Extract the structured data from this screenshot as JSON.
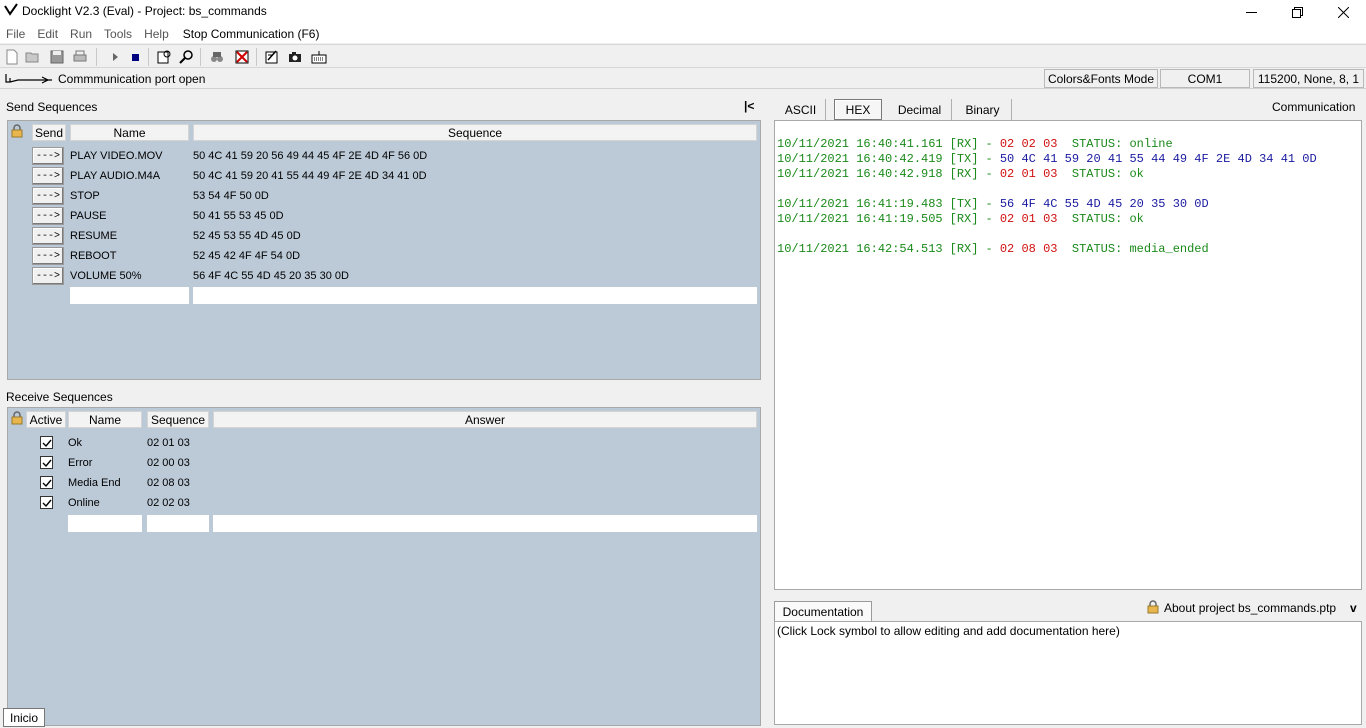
{
  "window": {
    "title": "Docklight V2.3 (Eval) - Project: bs_commands"
  },
  "menu": {
    "items": [
      "File",
      "Edit",
      "Run",
      "Tools",
      "Help"
    ],
    "command": "Stop Communication  (F6)"
  },
  "toolbar": {
    "icons": [
      "new-icon",
      "open-icon",
      "save-icon",
      "print-icon",
      "play-icon",
      "stop-icon",
      "settings-icon",
      "search-icon",
      "find-icon",
      "clear-icon",
      "script-icon",
      "snapshot-icon",
      "keyboard-icon"
    ]
  },
  "status": {
    "message": "Commmunication port open",
    "mode": "Colors&Fonts Mode",
    "port": "COM1",
    "settings": "115200, None, 8, 1"
  },
  "send": {
    "title": "Send Sequences",
    "collapse_glyph": "|<",
    "headers": {
      "send": "Send",
      "name": "Name",
      "sequence": "Sequence"
    },
    "button_label": "--->",
    "rows": [
      {
        "name": "PLAY VIDEO.MOV",
        "sequence": "50 4C 41 59 20 56 49 44 45 4F 2E 4D 4F 56 0D"
      },
      {
        "name": "PLAY AUDIO.M4A",
        "sequence": "50 4C 41 59 20 41 55 44 49 4F 2E 4D 34 41 0D"
      },
      {
        "name": "STOP",
        "sequence": "53 54 4F 50 0D"
      },
      {
        "name": "PAUSE",
        "sequence": "50 41 55 53 45 0D"
      },
      {
        "name": "RESUME",
        "sequence": "52 45 53 55 4D 45 0D"
      },
      {
        "name": "REBOOT",
        "sequence": "52 45 42 4F 4F 54 0D"
      },
      {
        "name": "VOLUME 50%",
        "sequence": "56 4F 4C 55 4D 45 20 35 30 0D"
      }
    ]
  },
  "receive": {
    "title": "Receive Sequences",
    "headers": {
      "active": "Active",
      "name": "Name",
      "sequence": "Sequence",
      "answer": "Answer"
    },
    "rows": [
      {
        "active": true,
        "name": "Ok",
        "sequence": "02 01 03"
      },
      {
        "active": true,
        "name": "Error",
        "sequence": "02 00 03"
      },
      {
        "active": true,
        "name": "Media End",
        "sequence": "02 08 03"
      },
      {
        "active": true,
        "name": "Online",
        "sequence": "02 02 03"
      }
    ]
  },
  "communication": {
    "title": "Communication",
    "tabs": [
      "ASCII",
      "HEX",
      "Decimal",
      "Binary"
    ],
    "active_tab": "HEX",
    "log": [
      {
        "ts": "10/11/2021 16:40:41.161",
        "dir": "[RX]",
        "bytes": "02 02 03",
        "status": "  STATUS: online"
      },
      {
        "ts": "10/11/2021 16:40:42.419",
        "dir": "[TX]",
        "bytes": "50 4C 41 59 20 41 55 44 49 4F 2E 4D 34 41 0D",
        "status": ""
      },
      {
        "ts": "10/11/2021 16:40:42.918",
        "dir": "[RX]",
        "bytes": "02 01 03",
        "status": "  STATUS: ok"
      },
      {
        "ts": "10/11/2021 16:41:19.483",
        "dir": "[TX]",
        "bytes": "56 4F 4C 55 4D 45 20 35 30 0D",
        "status": ""
      },
      {
        "ts": "10/11/2021 16:41:19.505",
        "dir": "[RX]",
        "bytes": "02 01 03",
        "status": "  STATUS: ok"
      },
      {
        "ts": "10/11/2021 16:42:54.513",
        "dir": "[RX]",
        "bytes": "02 08 03",
        "status": "  STATUS: media_ended"
      }
    ],
    "colors": {
      "rx_bytes": "#d01010",
      "tx_bytes": "#1a1aa0",
      "text": "#1a8a1a"
    }
  },
  "documentation": {
    "tab": "Documentation",
    "about": "About project bs_commands.ptp",
    "expand_glyph": "v",
    "text": "(Click Lock symbol to allow editing and add documentation here)"
  },
  "tooltip": {
    "text": "Inicio"
  }
}
